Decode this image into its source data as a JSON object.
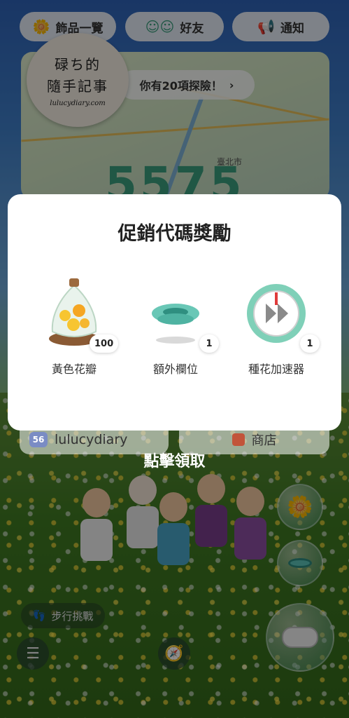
{
  "top_bar": {
    "accessories_label": "飾品一覽",
    "friends_label": "好友",
    "notifications_label": "通知"
  },
  "map": {
    "explore_label": "你有20項探險！",
    "steps": "5575",
    "city_label": "臺北市"
  },
  "watermark": {
    "line1": "碌ち的",
    "line2": "隨手記事",
    "site": "lulucydiary.com"
  },
  "modal": {
    "title": "促銷代碼獎勵",
    "rewards": [
      {
        "label": "黃色花瓣",
        "count": "100"
      },
      {
        "label": "額外欄位",
        "count": "1"
      },
      {
        "label": "種花加速器",
        "count": "1"
      }
    ]
  },
  "profile": {
    "level": "56",
    "username": "lulucydiary"
  },
  "shop_label": "商店",
  "claim_hint": "點擊領取",
  "walk_challenge_label": "步行挑戰",
  "colors": {
    "accent_green": "#3b9e7e",
    "modal_bg": "#ffffff"
  }
}
